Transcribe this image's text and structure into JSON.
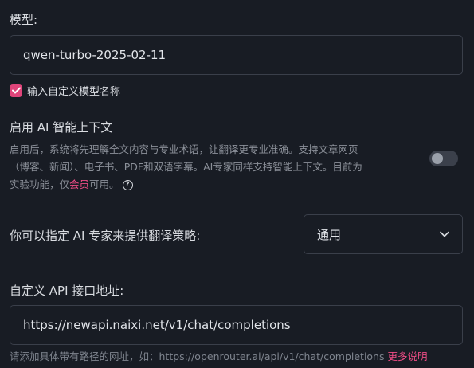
{
  "model": {
    "label": "模型:",
    "value": "qwen-turbo-2025-02-11",
    "custom_checkbox_label": "输入自定义模型名称"
  },
  "context": {
    "title": "启用 AI 智能上下文",
    "desc_line1": "启用后，系统将先理解全文内容与专业术语，让翻译更专业准确。支持文章网页",
    "desc_line2": "（博客、新闻）、电子书、PDF和双语字幕。AI专家同样支持智能上下文。目前为",
    "desc_line3_pre": "实验功能，仅",
    "desc_line3_link": "会员",
    "desc_line3_post": "可用。",
    "help_glyph": "?"
  },
  "expert": {
    "label": "你可以指定 AI 专家来提供翻译策略:",
    "selected": "通用"
  },
  "api": {
    "label": "自定义 API 接口地址:",
    "value": "https://newapi.naixi.net/v1/chat/completions",
    "hint": "请添加具体带有路径的网址，如：https://openrouter.ai/api/v1/chat/completions",
    "more_link": "更多说明"
  },
  "colors": {
    "background": "#181c24",
    "accent": "#ee4d86",
    "checkbox": "#e0447a",
    "border": "#3a3f4a"
  }
}
